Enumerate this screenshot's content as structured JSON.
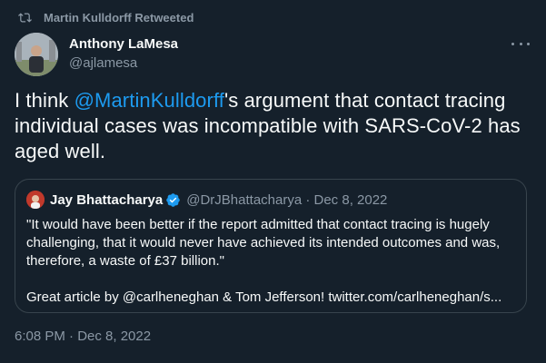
{
  "retweet": {
    "label": "Martin Kulldorff Retweeted",
    "icon": "retweet-icon"
  },
  "author": {
    "name": "Anthony LaMesa",
    "handle": "@ajlamesa"
  },
  "tweet": {
    "text_before": "I think ",
    "mention": "@MartinKulldorff",
    "text_after": "'s argument that contact tracing individual cases was incompatible with SARS-CoV-2 has aged well."
  },
  "quote": {
    "name": "Jay Bhattacharya",
    "meta": "@DrJBhattacharya · Dec 8, 2022",
    "line1": "\"It would have been better if the report admitted that contact tracing is hugely challenging, that it would never have achieved its intended outcomes and was, therefore, a waste of £37 billion.\"",
    "line2": "Great article by @carlheneghan & Tom Jefferson! twitter.com/carlheneghan/s..."
  },
  "timestamp": "6:08 PM · Dec 8, 2022",
  "colors": {
    "background": "#15202b",
    "text": "#f7f9f9",
    "muted": "#8b98a5",
    "accent": "#1d9bf0",
    "border": "#38444d"
  }
}
